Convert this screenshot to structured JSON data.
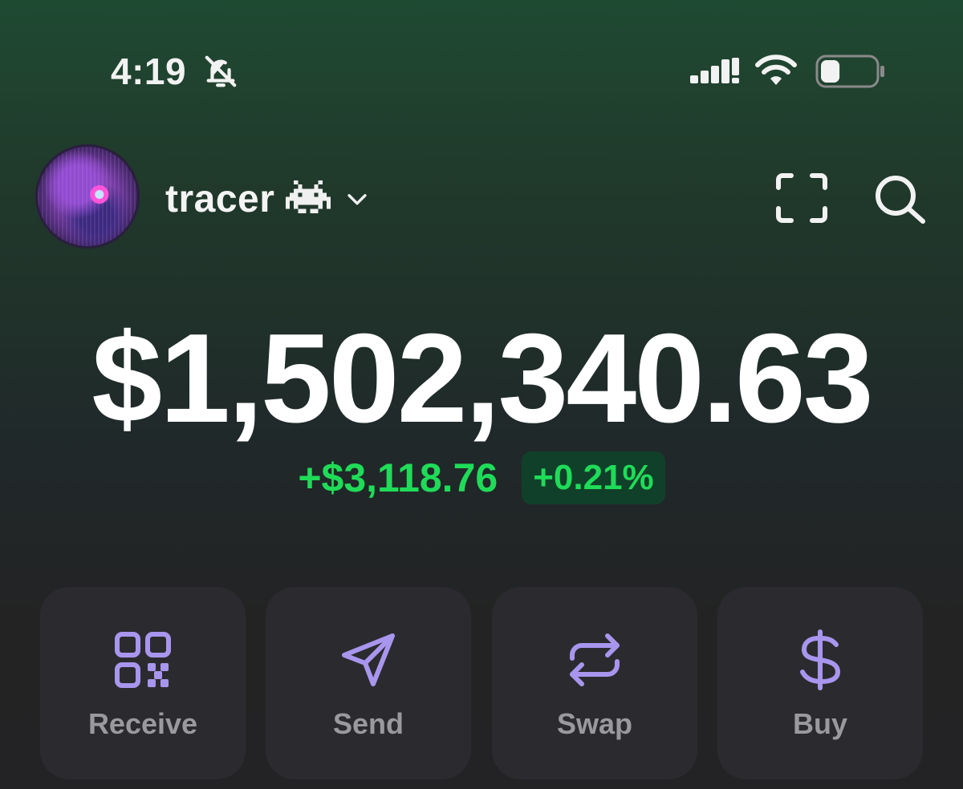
{
  "status_bar": {
    "time": "4:19",
    "bell_icon": "bell-slash-icon",
    "signal_icon": "cellular-signal-icon",
    "wifi_icon": "wifi-icon",
    "battery_icon": "battery-icon",
    "battery_level": 0.35
  },
  "header": {
    "avatar_icon": "profile-avatar",
    "account_name": "tracer",
    "account_emoji_icon": "alien-monster-icon",
    "chevron_icon": "chevron-down-icon",
    "scan_icon": "scan-frame-icon",
    "search_icon": "search-icon"
  },
  "portfolio": {
    "balance": "$1,502,340.63",
    "change_amount": "+$3,118.76",
    "change_percent": "+0.21%"
  },
  "actions": [
    {
      "label": "Receive",
      "icon": "qr-code-icon"
    },
    {
      "label": "Send",
      "icon": "paper-plane-icon"
    },
    {
      "label": "Swap",
      "icon": "swap-arrows-icon"
    },
    {
      "label": "Buy",
      "icon": "dollar-icon"
    }
  ],
  "colors": {
    "positive": "#1fdc58",
    "positive_bg": "#11402a",
    "accent": "#a896ee",
    "card_bg": "#2b2b2f",
    "label": "#9a9a9e"
  }
}
